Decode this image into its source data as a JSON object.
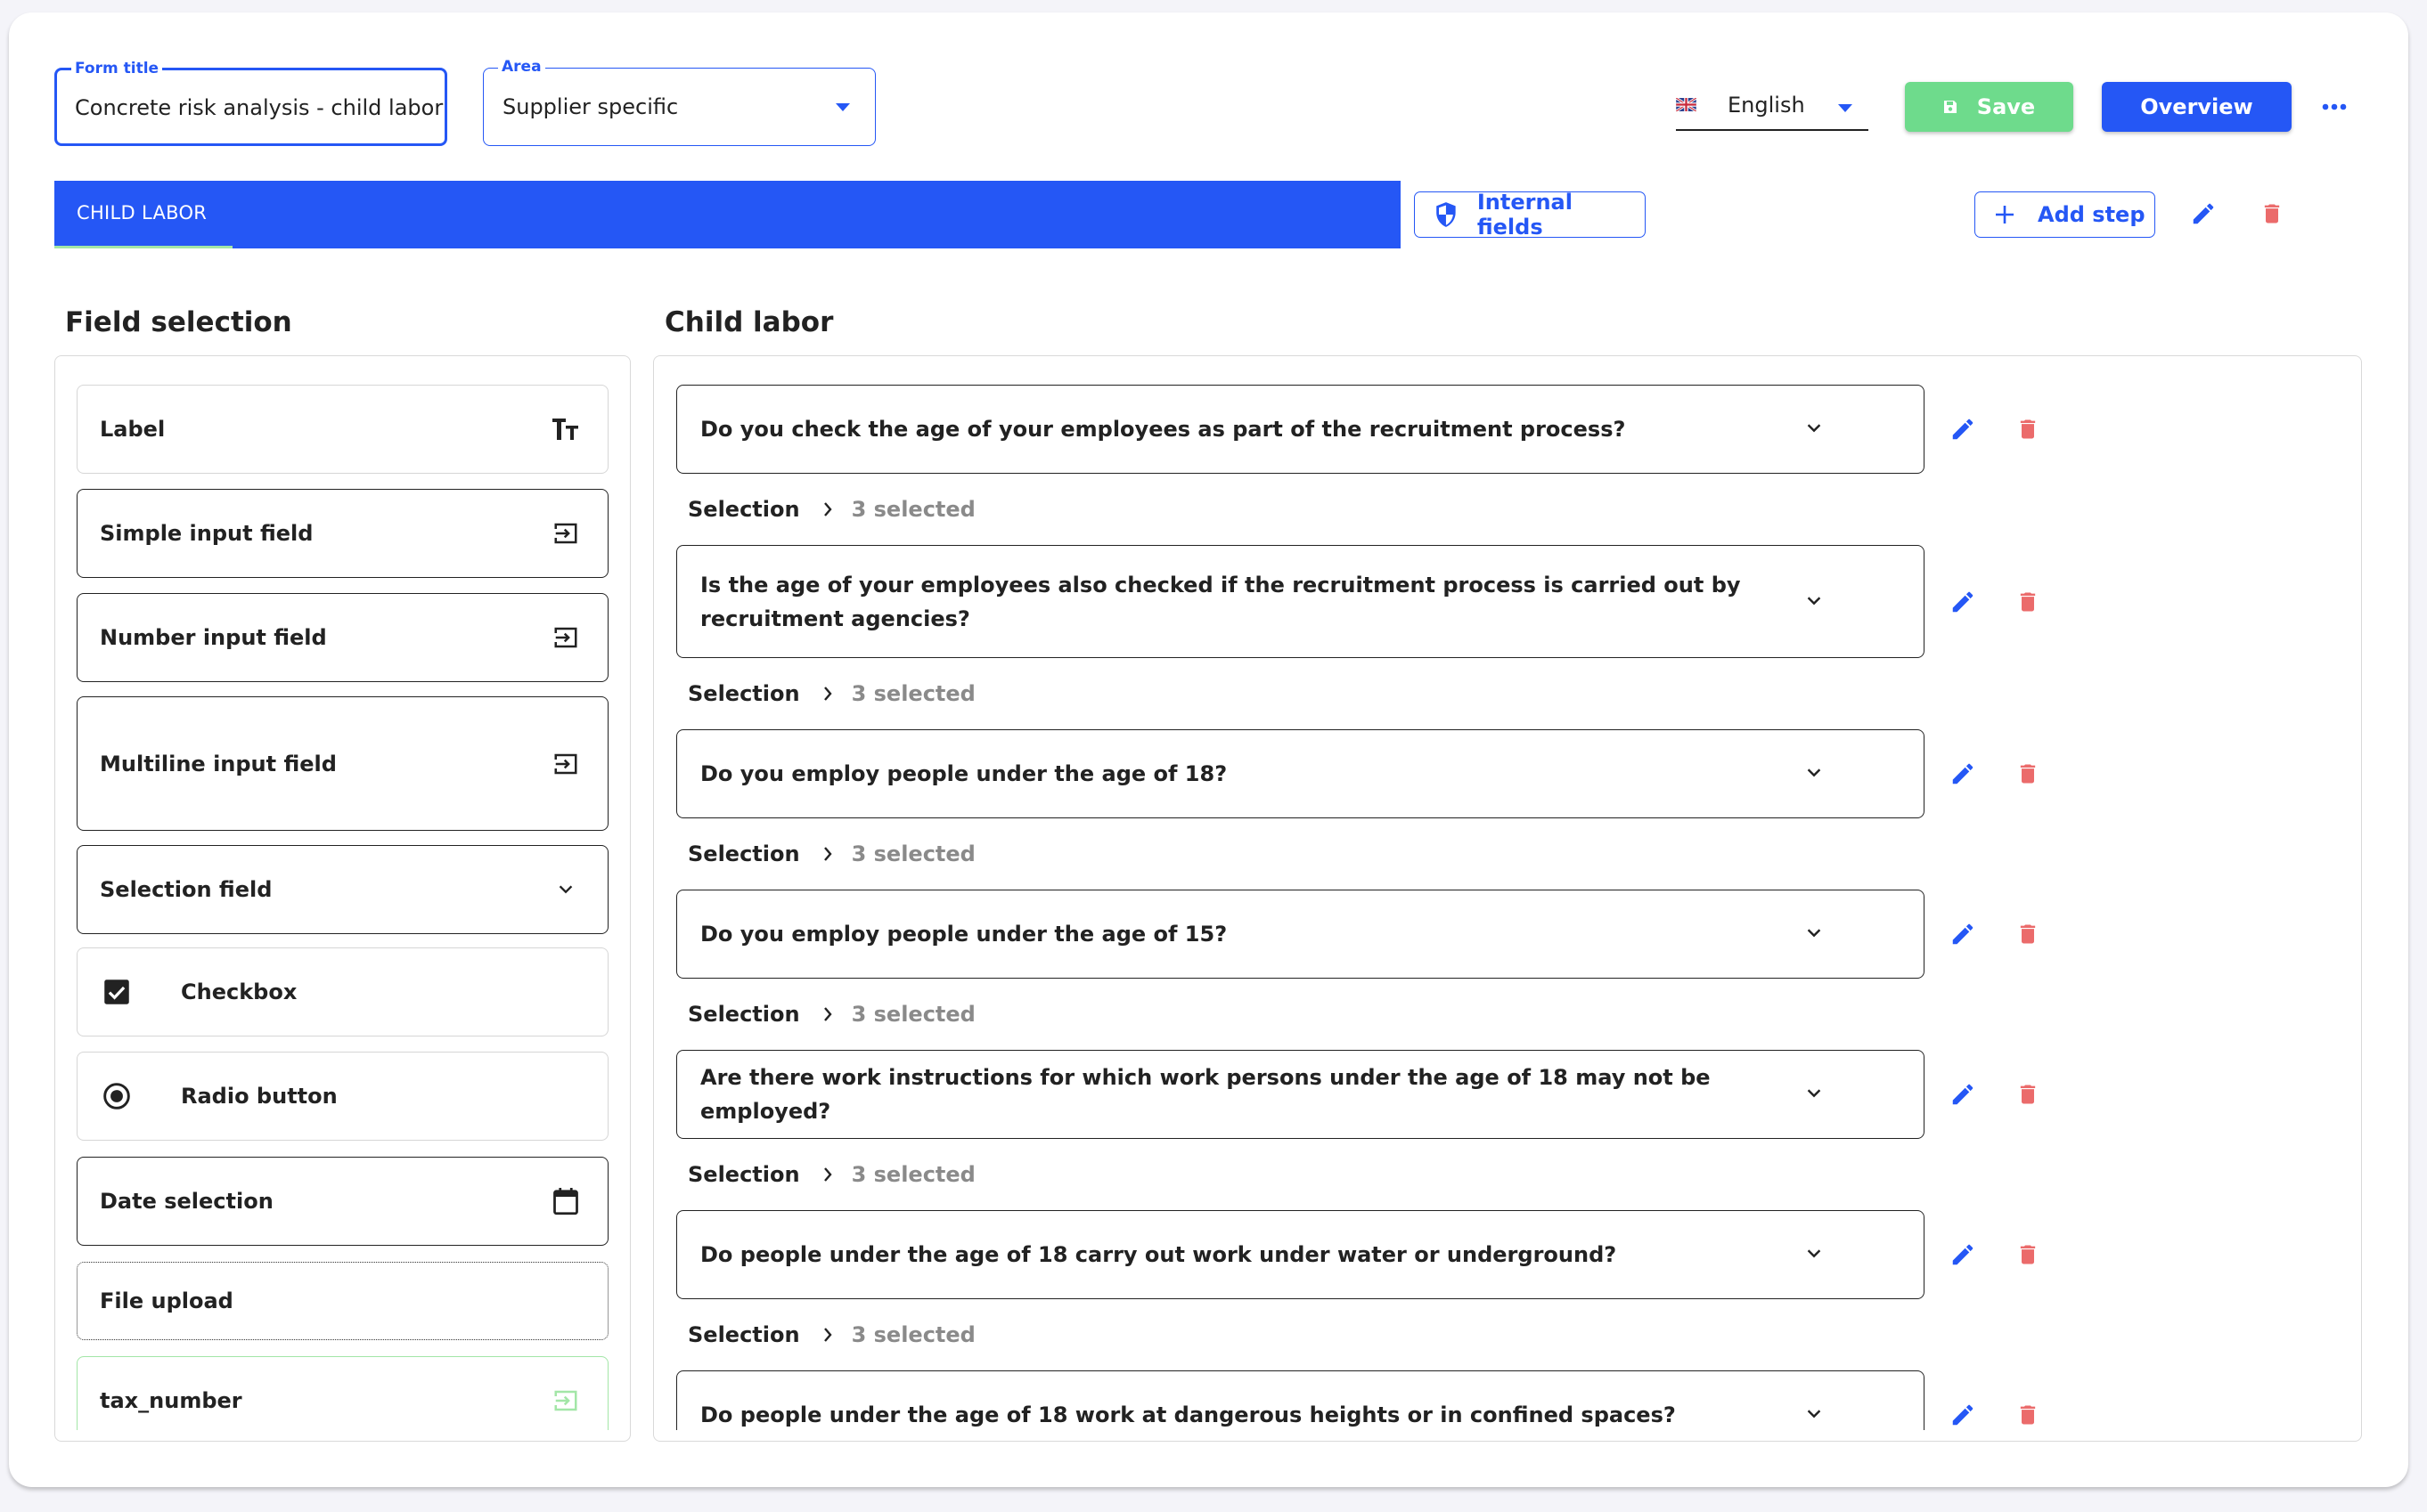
{
  "header": {
    "form_title": {
      "label": "Form title",
      "value": "Concrete risk analysis - child labor"
    },
    "area": {
      "label": "Area",
      "value": "Supplier specific"
    },
    "language": {
      "value": "English",
      "flag": "uk-flag-icon"
    },
    "save_label": "Save",
    "overview_label": "Overview",
    "more_label": "•••"
  },
  "tabs": [
    {
      "label": "CHILD LABOR",
      "active": true
    }
  ],
  "step_actions": {
    "internal_fields_label": "Internal fields",
    "add_step_label": "Add step"
  },
  "colors": {
    "primary": "#2557f5",
    "success": "#6edb8c",
    "danger": "#eb6b6b",
    "tab_indicator": "#a3e6a7"
  },
  "field_selection": {
    "title": "Field selection",
    "items": [
      {
        "label": "Label",
        "icon": "text-format-icon"
      },
      {
        "label": "Simple input field",
        "icon": "input-icon"
      },
      {
        "label": "Number input field",
        "icon": "input-icon"
      },
      {
        "label": "Multiline input field",
        "icon": "input-icon"
      },
      {
        "label": "Selection field",
        "icon": "chevron-down-icon"
      },
      {
        "label": "Checkbox",
        "icon": "checkbox-checked-icon"
      },
      {
        "label": "Radio button",
        "icon": "radio-checked-icon"
      },
      {
        "label": "Date selection",
        "icon": "calendar-icon"
      },
      {
        "label": "File upload",
        "icon": ""
      },
      {
        "label": "tax_number",
        "icon": "input-icon"
      }
    ]
  },
  "step": {
    "title": "Child labor",
    "questions": [
      {
        "text": "Do you check the age of your employees as part of the recruitment process?",
        "selection_label": "Selection",
        "selected": "3 selected"
      },
      {
        "text": "Is the age of your employees also checked if the recruitment process is carried out by recruitment agencies?",
        "selection_label": "Selection",
        "selected": "3 selected"
      },
      {
        "text": "Do you employ people under the age of 18?",
        "selection_label": "Selection",
        "selected": "3 selected"
      },
      {
        "text": "Do you employ people under the age of 15?",
        "selection_label": "Selection",
        "selected": "3 selected"
      },
      {
        "text": "Are there work instructions for which work persons under the age of 18 may not be employed?",
        "selection_label": "Selection",
        "selected": "3 selected"
      },
      {
        "text": "Do people under the age of 18 carry out work under water or underground?",
        "selection_label": "Selection",
        "selected": "3 selected"
      },
      {
        "text": "Do people under the age of 18 work at dangerous heights or in confined spaces?"
      }
    ]
  }
}
